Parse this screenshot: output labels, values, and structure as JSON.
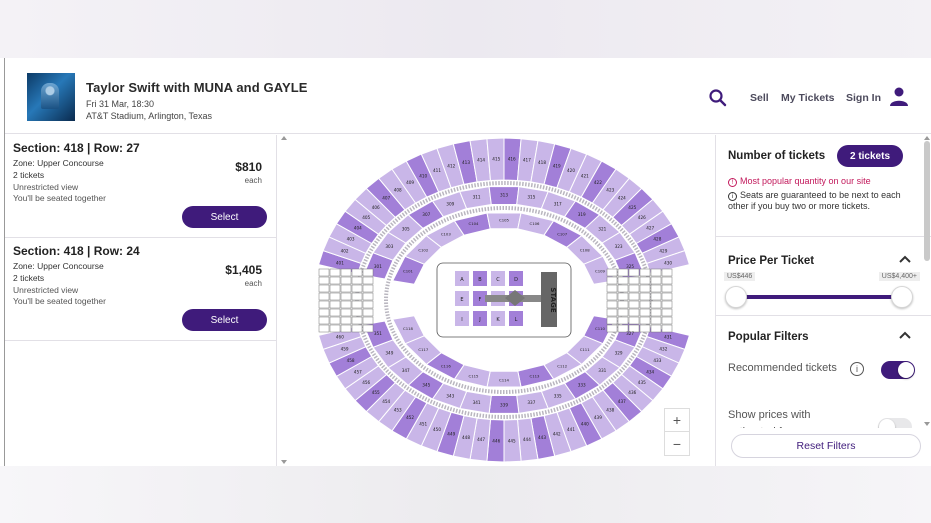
{
  "event": {
    "title": "Taylor Swift with MUNA and GAYLE",
    "date": "Fri 31 Mar, 18:30",
    "venue": "AT&T Stadium, Arlington, Texas"
  },
  "nav": {
    "sell": "Sell",
    "my_tickets": "My Tickets",
    "sign_in": "Sign In",
    "search_icon": "search-icon",
    "avatar_icon": "user-icon"
  },
  "listings": [
    {
      "section": "Section: 418 | Row: 27",
      "zone": "Zone: Upper Concourse",
      "qty": "2 tickets",
      "view": "Unrestricted view",
      "seating": "You'll be seated together",
      "price": "$810",
      "each": "each",
      "select": "Select"
    },
    {
      "section": "Section: 418 | Row: 24",
      "zone": "Zone: Upper Concourse",
      "qty": "2 tickets",
      "view": "Unrestricted view",
      "seating": "You'll be seated together",
      "price": "$1,405",
      "each": "each",
      "select": "Select"
    }
  ],
  "map": {
    "stage_label": "STAGE",
    "upper_sections": [
      "401",
      "402",
      "403",
      "404",
      "405",
      "406",
      "407",
      "408",
      "409",
      "410",
      "411",
      "412",
      "413",
      "414",
      "415",
      "416",
      "417",
      "418",
      "419",
      "420",
      "421",
      "422",
      "423",
      "424",
      "425",
      "426",
      "427",
      "428",
      "429",
      "430",
      "431",
      "432",
      "433",
      "434",
      "435",
      "436",
      "437",
      "438",
      "439",
      "440",
      "441",
      "442",
      "443",
      "444",
      "445",
      "446",
      "447",
      "448",
      "449",
      "450",
      "451",
      "452",
      "453",
      "454",
      "455",
      "456",
      "457",
      "458",
      "459",
      "460"
    ],
    "mid_sections": [
      "301",
      "303",
      "305",
      "307",
      "309",
      "311",
      "313",
      "315",
      "317",
      "319",
      "321",
      "323",
      "325",
      "327",
      "329",
      "331",
      "333",
      "335",
      "337",
      "339",
      "341",
      "343",
      "345",
      "347",
      "349",
      "351"
    ],
    "lower_sections": [
      "C101",
      "C102",
      "C103",
      "C104",
      "C105",
      "C106",
      "C107",
      "C108",
      "C109",
      "C110",
      "C111",
      "C112",
      "C113",
      "C114",
      "C115",
      "C116",
      "C117",
      "C118"
    ],
    "floor_sections": [
      "A",
      "B",
      "C",
      "D",
      "E",
      "F",
      "G",
      "H",
      "I",
      "J",
      "K",
      "L"
    ],
    "zoom_in": "+",
    "zoom_out": "−"
  },
  "filters": {
    "number_label": "Number of tickets",
    "number_value": "2 tickets",
    "popular_note": "Most popular quantity on our site",
    "guarantee_note": "Seats are guaranteed to be next to each other if you buy two or more tickets.",
    "price_title": "Price Per Ticket",
    "price_min": "US$446",
    "price_max": "US$4,400+",
    "price_range_fraction": [
      0,
      1
    ],
    "popular_title": "Popular Filters",
    "recommended_label": "Recommended tickets",
    "recommended_on": true,
    "show_fees_label": "Show prices with estimated fees",
    "show_fees_on": false,
    "reset": "Reset Filters"
  },
  "colors": {
    "brand": "#3f1b7b",
    "accent_pink": "#c2185b",
    "section_fill": "#c9b6e8",
    "section_available": "#a27fd8"
  }
}
